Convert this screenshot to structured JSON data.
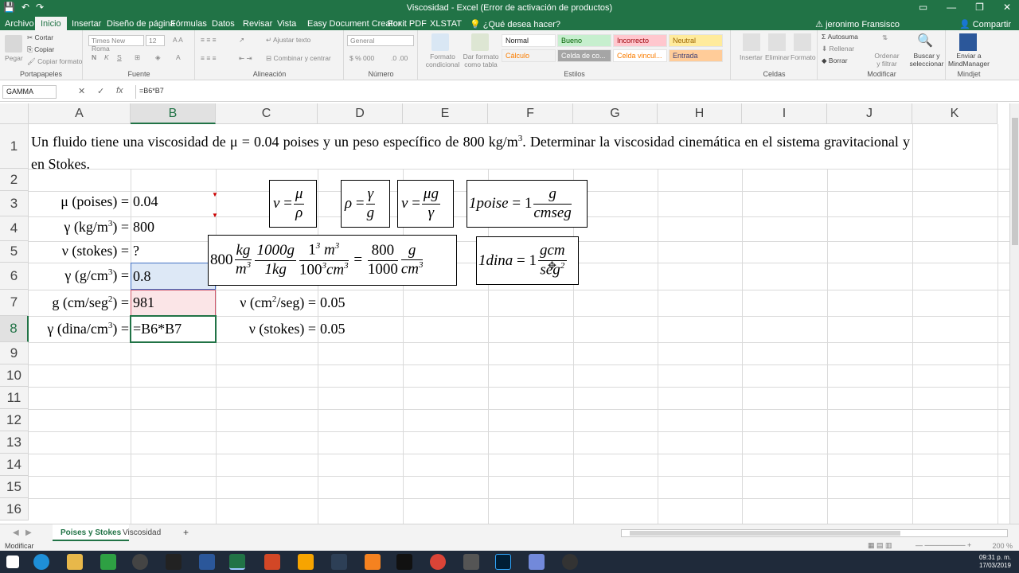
{
  "window": {
    "title": "Viscosidad - Excel (Error de activación de productos)",
    "controls": [
      "▭",
      "—",
      "❐",
      "✕"
    ]
  },
  "ribbon_tabs": {
    "archivo": "Archivo",
    "items": [
      "Inicio",
      "Insertar",
      "Diseño de página",
      "Fórmulas",
      "Datos",
      "Revisar",
      "Vista",
      "Easy Document Creator",
      "Foxit PDF",
      "XLSTAT"
    ],
    "tell_me": "¿Qué desea hacer?",
    "user": "jeronimo Fransisco",
    "share": "Compartir"
  },
  "ribbon": {
    "clipboard": {
      "label": "Portapapeles",
      "paste": "Pegar",
      "cut": "Cortar",
      "copy": "Copiar",
      "format_painter": "Copiar formato"
    },
    "font": {
      "label": "Fuente",
      "font_name": "Times New Roma",
      "font_size": "12",
      "bold": "N",
      "italic": "K",
      "underline": "S"
    },
    "alignment": {
      "label": "Alineación",
      "wrap": "Ajustar texto",
      "merge": "Combinar y centrar"
    },
    "number": {
      "label": "Número",
      "format": "General"
    },
    "styles": {
      "label": "Estilos",
      "conditional": "Formato condicional",
      "as_table": "Dar formato como tabla",
      "cells": [
        "Normal",
        "Bueno",
        "Incorrecto",
        "Neutral",
        "Cálculo",
        "Celda de co...",
        "Celda vincul...",
        "Entrada"
      ]
    },
    "cells": {
      "label": "Celdas",
      "insert": "Insertar",
      "delete": "Eliminar",
      "format": "Formato"
    },
    "editing": {
      "label": "Modificar",
      "autosum": "Autosuma",
      "fill": "Rellenar",
      "clear": "Borrar",
      "sort": "Ordenar y filtrar",
      "find": "Buscar y seleccionar"
    },
    "mindjet": {
      "label": "Mindjet",
      "send": "Enviar a MindManager"
    }
  },
  "formula_bar": {
    "name_box": "GAMMA",
    "formula": "=B6*B7",
    "cancel": "✕",
    "enter": "✓",
    "fx": "fx"
  },
  "grid": {
    "columns": [
      "A",
      "B",
      "C",
      "D",
      "E",
      "F",
      "G",
      "H",
      "I",
      "J",
      "K"
    ],
    "rows": [
      "1",
      "2",
      "3",
      "4",
      "5",
      "6",
      "7",
      "8",
      "9",
      "10",
      "11",
      "12",
      "13",
      "14",
      "15",
      "16"
    ],
    "selected_column": "B",
    "selected_row": "8"
  },
  "content": {
    "problem": "Un fluido tiene una viscosidad de  μ = 0.04 poises y un peso específico de 800 kg/m",
    "problem_sup": "3",
    "problem_end": ". Determinar la viscosidad cinemática en el sistema gravitacional y en Stokes.",
    "a3": "μ (poises) =",
    "b3": "0.04",
    "a4_pre": "γ (kg/m",
    "a4_sup": "3",
    "a4_post": ") =",
    "b4": "800",
    "a5": "ν (stokes) =",
    "b5": "?",
    "a6_pre": "γ (g/cm",
    "a6_sup": "3",
    "a6_post": ") =",
    "b6": "0.8",
    "a7_pre": "g (cm/seg",
    "a7_sup": "2",
    "a7_post": ") =",
    "b7": "981",
    "a8_pre": "γ (dina/cm",
    "a8_sup": "3",
    "a8_post": ") =",
    "b8": "=B6*B7",
    "c7_pre": "ν (cm",
    "c7_sup": "2",
    "c7_post": "/seg) =",
    "d7": "0.05",
    "c8": "ν (stokes) =",
    "d8": "0.05"
  },
  "equations": {
    "nu": {
      "lhs": "ν",
      "num": "μ",
      "den": "ρ"
    },
    "rho": {
      "lhs": "ρ",
      "num": "γ",
      "den": "g"
    },
    "nu2": {
      "lhs": "ν",
      "num": "μg",
      "den": "γ"
    },
    "poise": {
      "lhs": "1poise",
      "one": "1",
      "num": "g",
      "den": "cmseg"
    },
    "conversion": {
      "a": "800",
      "kg": "kg",
      "m3": "m",
      "e3": "3",
      "c1": "1000g",
      "c2": "1kg",
      "n1": "1",
      "m": "m",
      "d1": "100",
      "cm": "cm",
      "r1": "800",
      "r2": "1000",
      "g": "g"
    },
    "dina": {
      "lhs": "1dina",
      "one": "1",
      "num": "gcm",
      "den": "seg",
      "den_sup": "2"
    }
  },
  "sheets": {
    "active": "Poises y Stokes",
    "other": "Viscosidad",
    "add": "+"
  },
  "status": {
    "mode": "Modificar",
    "zoom": "200 %"
  },
  "clock": {
    "time": "09:31 p. m.",
    "date": "17/03/2019"
  }
}
